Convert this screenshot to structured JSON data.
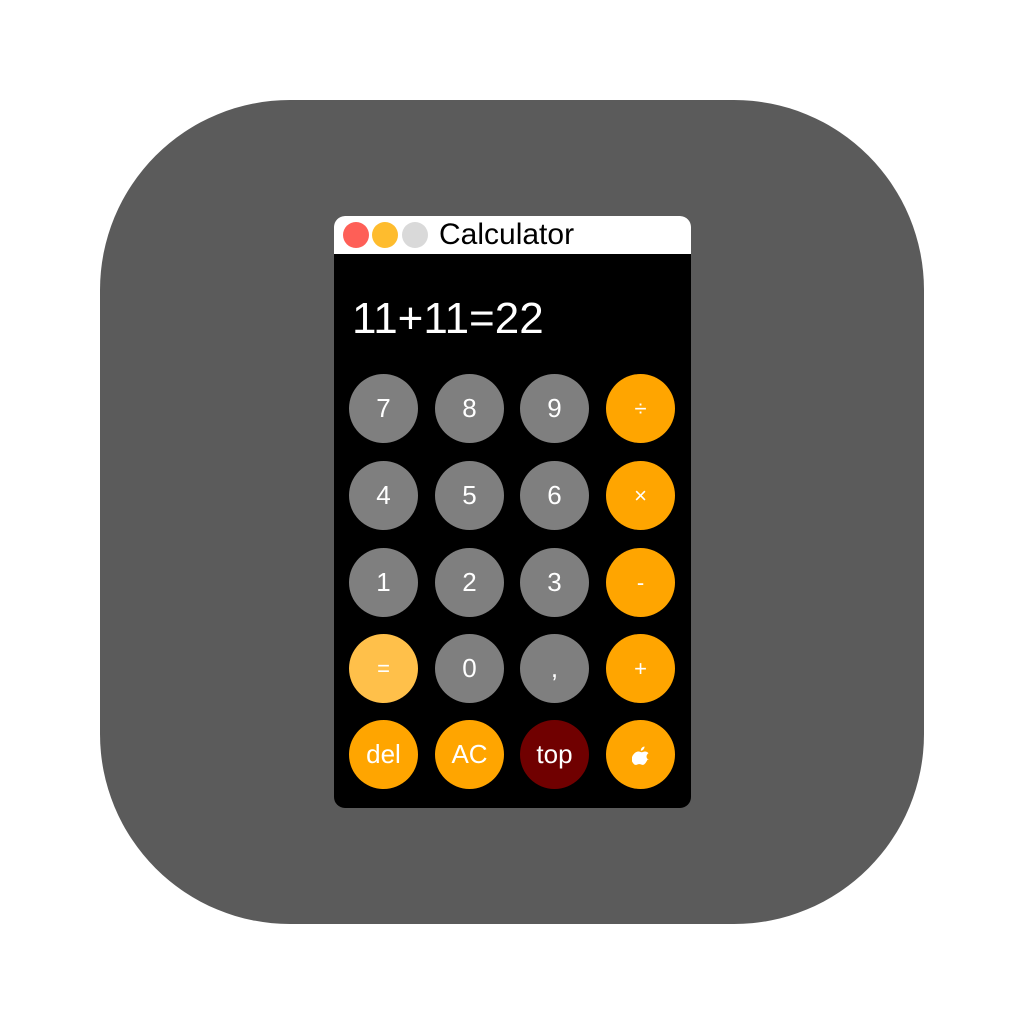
{
  "window": {
    "title": "Calculator"
  },
  "colors": {
    "icon_background": "#5b5b5b",
    "window_background": "#000000",
    "titlebar": "#ffffff",
    "close": "#fe5f57",
    "minimize": "#febc2e",
    "maximize": "#d9d9d9",
    "number_key": "#7f7f7f",
    "operator_key": "#ffa500",
    "equals_key": "#ffc04a",
    "top_key": "#700000"
  },
  "display": {
    "value": "11+11=22"
  },
  "keys": [
    {
      "label": "7",
      "name": "key-7",
      "type": "number"
    },
    {
      "label": "8",
      "name": "key-8",
      "type": "number"
    },
    {
      "label": "9",
      "name": "key-9",
      "type": "number"
    },
    {
      "label": "÷",
      "name": "divide-button",
      "type": "operator"
    },
    {
      "label": "4",
      "name": "key-4",
      "type": "number"
    },
    {
      "label": "5",
      "name": "key-5",
      "type": "number"
    },
    {
      "label": "6",
      "name": "key-6",
      "type": "number"
    },
    {
      "label": "×",
      "name": "multiply-button",
      "type": "operator"
    },
    {
      "label": "1",
      "name": "key-1",
      "type": "number"
    },
    {
      "label": "2",
      "name": "key-2",
      "type": "number"
    },
    {
      "label": "3",
      "name": "key-3",
      "type": "number"
    },
    {
      "label": "-",
      "name": "subtract-button",
      "type": "operator"
    },
    {
      "label": "=",
      "name": "equals-button",
      "type": "equals"
    },
    {
      "label": "0",
      "name": "key-0",
      "type": "number"
    },
    {
      "label": ",",
      "name": "comma-button",
      "type": "number"
    },
    {
      "label": "+",
      "name": "add-button",
      "type": "operator"
    },
    {
      "label": "del",
      "name": "delete-button",
      "type": "operator"
    },
    {
      "label": "AC",
      "name": "all-clear-button",
      "type": "operator"
    },
    {
      "label": "top",
      "name": "top-button",
      "type": "top"
    },
    {
      "label": "",
      "name": "apple-button",
      "type": "operator",
      "icon": "apple-icon"
    }
  ]
}
